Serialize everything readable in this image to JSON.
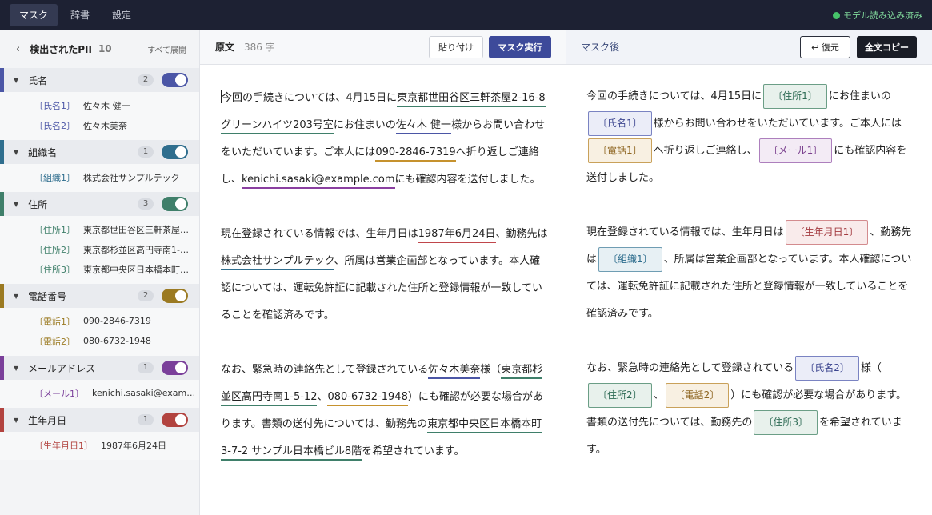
{
  "nav": {
    "tabs": [
      {
        "label": "マスク"
      },
      {
        "label": "辞書"
      },
      {
        "label": "設定"
      }
    ],
    "status": "モデル読み込み済み",
    "status_color": "#46c36a"
  },
  "sidebar": {
    "back": "‹",
    "title": "検出されたPII",
    "count": "10",
    "expand_all": "すべて展開",
    "groups": [
      {
        "name": "氏名",
        "count": "2",
        "color": "#4b56a6",
        "items": [
          {
            "tag": "〔氏名1〕",
            "value": "佐々木 健一"
          },
          {
            "tag": "〔氏名2〕",
            "value": "佐々木美奈"
          }
        ]
      },
      {
        "name": "組織名",
        "count": "1",
        "color": "#2f6e8e",
        "items": [
          {
            "tag": "〔組織1〕",
            "value": "株式会社サンプルテック"
          }
        ]
      },
      {
        "name": "住所",
        "count": "3",
        "color": "#3f7f6a",
        "items": [
          {
            "tag": "〔住所1〕",
            "value": "東京都世田谷区三軒茶屋2-16-8 グリーンハイツ203号室"
          },
          {
            "tag": "〔住所2〕",
            "value": "東京都杉並区高円寺南1-5-12"
          },
          {
            "tag": "〔住所3〕",
            "value": "東京都中央区日本橋本町3-7-2 サンプル日本橋ビル8階"
          }
        ]
      },
      {
        "name": "電話番号",
        "count": "2",
        "color": "#9b7a22",
        "items": [
          {
            "tag": "〔電話1〕",
            "value": "090-2846-7319"
          },
          {
            "tag": "〔電話2〕",
            "value": "080-6732-1948"
          }
        ]
      },
      {
        "name": "メールアドレス",
        "count": "1",
        "color": "#7a3f9a",
        "items": [
          {
            "tag": "〔メール1〕",
            "value": "kenichi.sasaki@example.com"
          }
        ]
      },
      {
        "name": "生年月日",
        "count": "1",
        "color": "#b2433f",
        "items": [
          {
            "tag": "〔生年月日1〕",
            "value": "1987年6月24日"
          }
        ]
      }
    ]
  },
  "source": {
    "title": "原文",
    "char_count": "386 字",
    "paste_label": "貼り付け",
    "mask_label": "マスク実行",
    "p1": {
      "a": "今回の手続きについては、4月15日に",
      "addr1": "東京都世田谷区三軒茶屋2-16-8 グリーンハイツ203号室",
      "b": "にお住まいの",
      "name1": "佐々木 健一",
      "c": "様からお問い合わせをいただいています。ご本人には",
      "phone1": "090-2846-7319",
      "d": "へ折り返しご連絡し、",
      "mail1": "kenichi.sasaki@example.com",
      "e": "にも確認内容を送付しました。"
    },
    "p2": {
      "a": "現在登録されている情報では、生年月日は",
      "date1": "1987年6月24日",
      "b": "、勤務先は",
      "org1": "株式会社サンプルテック",
      "c": "、所属は営業企画部となっています。本人確認については、運転免許証に記載された住所と登録情報が一致していることを確認済みです。"
    },
    "p3": {
      "a": "なお、緊急時の連絡先として登録されている",
      "name2": "佐々木美奈",
      "b": "様（",
      "addr2": "東京都杉並区高円寺南1-5-12",
      "c": "、",
      "phone2": "080-6732-1948",
      "d": "）にも確認が必要な場合があります。書類の送付先については、勤務先の",
      "addr3": "東京都中央区日本橋本町3-7-2 サンプル日本橋ビル8階",
      "e": "を希望されています。"
    }
  },
  "masked": {
    "title": "マスク後",
    "restore_label": "↩ 復元",
    "copy_label": "全文コピー",
    "p1": {
      "a": "今回の手続きについては、4月15日に",
      "addr1": "〔住所1〕",
      "b": "にお住まいの",
      "name1": "〔氏名1〕",
      "c": "様からお問い合わせをいただいています。ご本人には",
      "phone1": "〔電話1〕",
      "d": "へ折り返しご連絡し、",
      "mail1": "〔メール1〕",
      "e": "にも確認内容を送付しました。"
    },
    "p2": {
      "a": "現在登録されている情報では、生年月日は",
      "date1": "〔生年月日1〕",
      "b": "、勤務先は",
      "org1": "〔組織1〕",
      "c": "、所属は営業企画部となっています。本人確認については、運転免許証に記載された住所と登録情報が一致していることを確認済みです。"
    },
    "p3": {
      "a": "なお、緊急時の連絡先として登録されている",
      "name2": "〔氏名2〕",
      "b": "様（",
      "addr2": "〔住所2〕",
      "c": "、",
      "phone2": "〔電話2〕",
      "d": "）にも確認が必要な場合があります。書類の送付先については、勤務先の",
      "addr3": "〔住所3〕",
      "e": "を希望されています。"
    }
  }
}
